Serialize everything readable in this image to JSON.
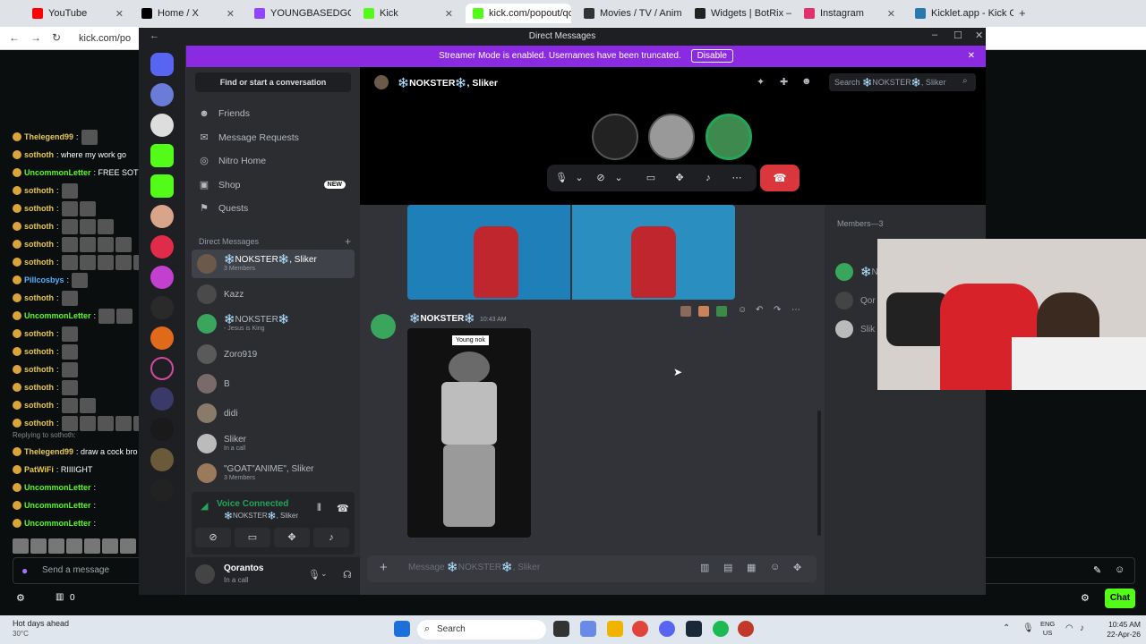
{
  "browser": {
    "tabs": [
      {
        "label": "YouTube",
        "color": "#ff0000"
      },
      {
        "label": "Home / X",
        "color": "#000000"
      },
      {
        "label": "YOUNGBASEDGO - T",
        "color": "#9146ff"
      },
      {
        "label": "Kick",
        "color": "#53fc18"
      },
      {
        "label": "kick.com/popout/qo",
        "color": "#53fc18"
      },
      {
        "label": "Movies / TV / Anime",
        "color": "#333333"
      },
      {
        "label": "Widgets | BotRix — (",
        "color": "#222222"
      },
      {
        "label": "Instagram",
        "color": "#e1306c"
      },
      {
        "label": "Kicklet.app - Kick Cha",
        "color": "#2a7ab0"
      }
    ],
    "address": "kick.com/po"
  },
  "kick_chat": {
    "lines": [
      {
        "user": "Thelegend99",
        "text": ":",
        "color": "#e7c84a",
        "emotes": 1
      },
      {
        "user": "sothoth",
        "text": ": where my work go",
        "color": "#e7c84a",
        "emotes": 0
      },
      {
        "user": "UncommonLetter",
        "text": ": FREE SOTH",
        "color": "#53fc18",
        "emotes": 0
      },
      {
        "user": "sothoth",
        "text": ":",
        "color": "#e7c84a",
        "emotes": 1
      },
      {
        "user": "sothoth",
        "text": ":",
        "color": "#e7c84a",
        "emotes": 2
      },
      {
        "user": "sothoth",
        "text": ":",
        "color": "#e7c84a",
        "emotes": 3
      },
      {
        "user": "sothoth",
        "text": ":",
        "color": "#e7c84a",
        "emotes": 4
      },
      {
        "user": "sothoth",
        "text": ":",
        "color": "#e7c84a",
        "emotes": 5
      },
      {
        "user": "Pillcosbys",
        "text": ":",
        "color": "#4fb3ff",
        "emotes": 1
      },
      {
        "user": "sothoth",
        "text": ":",
        "color": "#e7c84a",
        "emotes": 1
      },
      {
        "user": "UncommonLetter",
        "text": ":",
        "color": "#53fc18",
        "emotes": 2
      },
      {
        "user": "sothoth",
        "text": ":",
        "color": "#e7c84a",
        "emotes": 1
      },
      {
        "user": "sothoth",
        "text": ":",
        "color": "#e7c84a",
        "emotes": 1
      },
      {
        "user": "sothoth",
        "text": ":",
        "color": "#e7c84a",
        "emotes": 1
      },
      {
        "user": "sothoth",
        "text": ":",
        "color": "#e7c84a",
        "emotes": 1
      },
      {
        "user": "sothoth",
        "text": ":",
        "color": "#e7c84a",
        "emotes": 2
      },
      {
        "user": "sothoth",
        "text": ":",
        "color": "#e7c84a",
        "emotes": 5
      }
    ],
    "reply_note": "Replying to sothoth:",
    "lines2": [
      {
        "user": "Thelegend99",
        "text": ": draw a cock bro",
        "color": "#e7c84a"
      },
      {
        "user": "PatWiFi",
        "text": ": RIIIIGHT",
        "color": "#e7c84a"
      },
      {
        "user": "UncommonLetter",
        "text": ":",
        "color": "#53fc18"
      },
      {
        "user": "UncommonLetter",
        "text": ":",
        "color": "#53fc18"
      },
      {
        "user": "UncommonLetter",
        "text": ":",
        "color": "#53fc18"
      }
    ],
    "send_placeholder": "Send a message",
    "count": "0",
    "chat_button": "Chat"
  },
  "discord": {
    "window_title": "Direct Messages",
    "banner_text": "Streamer Mode is enabled. Usernames have been truncated.",
    "banner_button": "Disable",
    "find_placeholder": "Find or start a conversation",
    "nav": [
      {
        "label": "Friends",
        "icon": "friends-icon",
        "glyph": "☻"
      },
      {
        "label": "Message Requests",
        "icon": "mail-icon",
        "glyph": "✉"
      },
      {
        "label": "Nitro Home",
        "icon": "nitro-icon",
        "glyph": "◎"
      },
      {
        "label": "Shop",
        "icon": "shop-icon",
        "glyph": "▣",
        "badge": "NEW"
      },
      {
        "label": "Quests",
        "icon": "quests-icon",
        "glyph": "⚑"
      }
    ],
    "dm_header": "Direct Messages",
    "dms": [
      {
        "name": "❄️NOKSTER❄️, Sliker",
        "sub": "3 Members",
        "color": "#6b5a4a"
      },
      {
        "name": "Kazz",
        "sub": "",
        "color": "#4a4a4a"
      },
      {
        "name": "❄️NOKSTER❄️",
        "sub": "- Jesus is King",
        "color": "#3aa55c"
      },
      {
        "name": "Zoro919",
        "sub": "",
        "color": "#5a5a5a"
      },
      {
        "name": "B",
        "sub": "",
        "color": "#7a6a6a"
      },
      {
        "name": "didi",
        "sub": "",
        "color": "#8a7a6a"
      },
      {
        "name": "Sliker",
        "sub": "In a call",
        "color": "#bbbbbb"
      },
      {
        "name": "\"GOAT\"ANIME\", Sliker",
        "sub": "3 Members",
        "color": "#9a7a5a"
      }
    ],
    "voice": {
      "label": "Voice Connected",
      "channel": "❄️NOKSTER❄️, Sliker"
    },
    "user": {
      "name": "Qorantos",
      "status": "In a call"
    },
    "chat_title": "❄️NOKSTER❄️, Sliker",
    "search_placeholder": "Search ❄️NOKSTER❄️, Sliker",
    "message": {
      "author": "❄️NOKSTER❄️",
      "time": "10:43 AM",
      "image_caption": "Young nok"
    },
    "composer_placeholder": "Message ❄️NOKSTER❄️, Sliker",
    "members_header": "Members—3",
    "members": [
      {
        "name": "❄️NOKSTER❄️",
        "color": "#3aa55c"
      },
      {
        "name": "Qor",
        "color": "#444444"
      },
      {
        "name": "Slik",
        "color": "#bbbbbb"
      }
    ]
  },
  "taskbar": {
    "weather_title": "Hot days ahead",
    "weather_temp": "30°C",
    "search_label": "Search",
    "lang_top": "ENG",
    "lang_bottom": "US",
    "time": "10:45 AM",
    "date": "22-Apr-26"
  }
}
